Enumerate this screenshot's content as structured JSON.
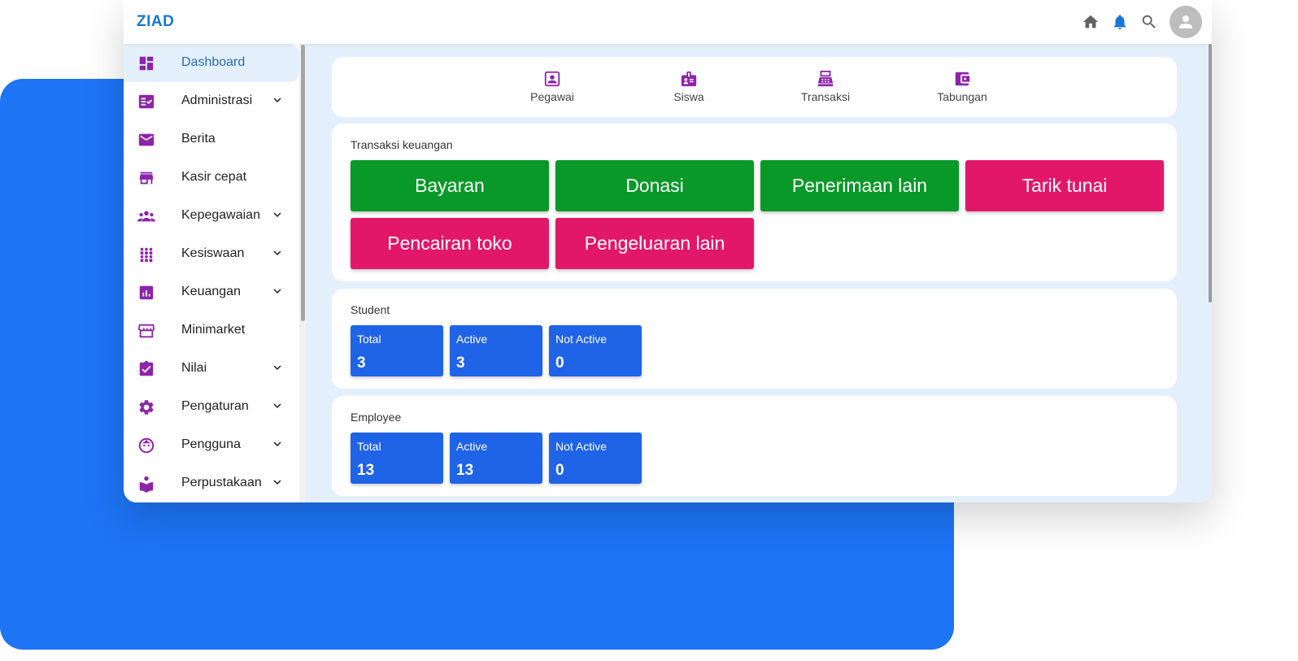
{
  "app": {
    "brand": "ZIAD"
  },
  "colors": {
    "accent": "#1976d2",
    "sidebar_icon": "#8e24aa",
    "green_button": "#089928",
    "pink_button": "#e3176a",
    "stat_card": "#1f63e6",
    "background_panel": "#1d74f5"
  },
  "topbar": {
    "icons": [
      "home-icon",
      "bell-icon",
      "search-icon",
      "account-avatar-icon"
    ]
  },
  "sidebar": {
    "items": [
      {
        "label": "Dashboard",
        "icon": "dashboard-icon",
        "expandable": false,
        "active": true
      },
      {
        "label": "Administrasi",
        "icon": "checklist-icon",
        "expandable": true
      },
      {
        "label": "Berita",
        "icon": "mail-icon",
        "expandable": false
      },
      {
        "label": "Kasir cepat",
        "icon": "store-icon",
        "expandable": false
      },
      {
        "label": "Kepegawaian",
        "icon": "group-icon",
        "expandable": true
      },
      {
        "label": "Kesiswaan",
        "icon": "students-icon",
        "expandable": true
      },
      {
        "label": "Keuangan",
        "icon": "finance-chart-icon",
        "expandable": true
      },
      {
        "label": "Minimarket",
        "icon": "storefront-icon",
        "expandable": false
      },
      {
        "label": "Nilai",
        "icon": "assignment-check-icon",
        "expandable": true
      },
      {
        "label": "Pengaturan",
        "icon": "gear-icon",
        "expandable": true
      },
      {
        "label": "Pengguna",
        "icon": "face-icon",
        "expandable": true
      },
      {
        "label": "Perpustakaan",
        "icon": "book-reader-icon",
        "expandable": true
      }
    ]
  },
  "quick_links": [
    {
      "label": "Pegawai",
      "icon": "id-badge-icon"
    },
    {
      "label": "Siswa",
      "icon": "student-badge-icon"
    },
    {
      "label": "Transaksi",
      "icon": "cash-register-icon"
    },
    {
      "label": "Tabungan",
      "icon": "wallet-icon"
    }
  ],
  "transactions": {
    "title": "Transaksi keuangan",
    "buttons": [
      {
        "label": "Bayaran",
        "color": "green"
      },
      {
        "label": "Donasi",
        "color": "green"
      },
      {
        "label": "Penerimaan lain",
        "color": "green"
      },
      {
        "label": "Tarik tunai",
        "color": "pink"
      },
      {
        "label": "Pencairan toko",
        "color": "pink"
      },
      {
        "label": "Pengeluaran lain",
        "color": "pink"
      }
    ]
  },
  "student": {
    "title": "Student",
    "stats": [
      {
        "label": "Total",
        "value": "3"
      },
      {
        "label": "Active",
        "value": "3"
      },
      {
        "label": "Not Active",
        "value": "0"
      }
    ]
  },
  "employee": {
    "title": "Employee",
    "stats": [
      {
        "label": "Total",
        "value": "13"
      },
      {
        "label": "Active",
        "value": "13"
      },
      {
        "label": "Not Active",
        "value": "0"
      }
    ]
  }
}
